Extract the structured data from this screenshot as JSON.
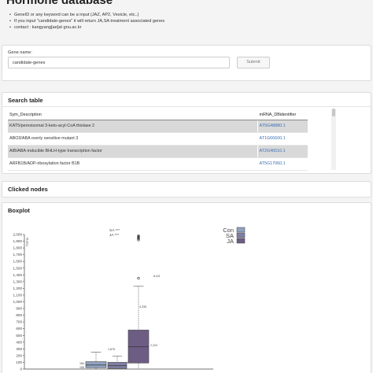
{
  "page": {
    "title": "Hormone database",
    "bullets": [
      "GeneID or any keyword can be a input (JAZ, AP2, Vesicle, etc..)",
      "If you input \"candidate-genes\" it will return JA,SA treatment associated genes",
      "contact : kangyang[ae]at gnu.ac.kr"
    ]
  },
  "gene_panel": {
    "label": "Gene name:",
    "input_value": "candidate-genes",
    "submit_label": "Submit"
  },
  "search_table": {
    "title": "Search table",
    "columns": [
      "Sym_Description",
      "mRNA_DBidentifier"
    ],
    "rows": [
      {
        "desc": "KAT5/peroxisomal 3-keto-acyl-CoA thiolase 2",
        "id": "AT5G48880.1"
      },
      {
        "desc": "ABO3/ABA overly sensitive mutant 3",
        "id": "AT1G66600.1"
      },
      {
        "desc": "AIB/ABA-inducible BHLH-type transcription factor",
        "id": "AT2G46510.1"
      },
      {
        "desc": "ARFB1B/ADP-ribosylation factor B1B",
        "id": "AT5G17060.1"
      }
    ]
  },
  "clicked_panel": {
    "title": "Clicked nodes"
  },
  "boxplot_panel": {
    "title": "Boxplot"
  },
  "chart_data": {
    "type": "box",
    "ylabel": "TRPM",
    "ylim": [
      0,
      2000
    ],
    "yticks": [
      "0",
      "100",
      "200",
      "300",
      "400",
      "500",
      "600",
      "700",
      "800",
      "900",
      "1,000",
      "1,100",
      "1,200",
      "1,300",
      "1,400",
      "1,500",
      "1,600",
      "1,700",
      "1,800",
      "1,900",
      "2,000"
    ],
    "legend": [
      {
        "name": "Con",
        "color": "#8fa2c0"
      },
      {
        "name": "SA",
        "color": "#7f7fa6"
      },
      {
        "name": "JA",
        "color": "#6d5d84"
      }
    ],
    "significance": [
      "SA ***",
      "JA ***"
    ],
    "series": [
      {
        "name": "Con",
        "color": "#8fa2c0",
        "min": 0,
        "q1": 20,
        "median": 60,
        "q3": 110,
        "max": 250
      },
      {
        "name": "SA",
        "color": "#7f7fa6",
        "min": 0,
        "q1": 10,
        "median": 50,
        "q3": 100,
        "max": 190
      },
      {
        "name": "JA",
        "color": "#6d5d84",
        "min": 0,
        "q1": 90,
        "median": 330,
        "q3": 580,
        "max": 1230,
        "outliers": [
          1350,
          1920,
          1940,
          1950,
          1960,
          1970,
          1980
        ]
      }
    ],
    "annotations": [
      "1,876",
      "4,338",
      "2,224",
      "8,411",
      "184",
      "106",
      "4"
    ]
  }
}
